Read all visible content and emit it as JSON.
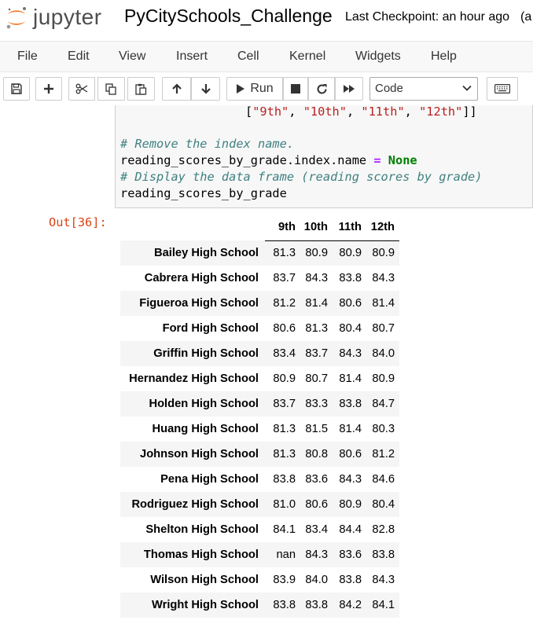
{
  "header": {
    "logo_text": "jupyter",
    "notebook_title": "PyCitySchools_Challenge",
    "checkpoint": "Last Checkpoint: an hour ago",
    "checkpoint_tail": "(a"
  },
  "menu": {
    "items": [
      "File",
      "Edit",
      "View",
      "Insert",
      "Cell",
      "Kernel",
      "Widgets",
      "Help"
    ]
  },
  "toolbar": {
    "run_label": "Run",
    "cell_type": "Code",
    "icons": [
      "save-icon",
      "plus-icon",
      "scissors-icon",
      "copy-icon",
      "paste-icon",
      "arrow-up-icon",
      "arrow-down-icon",
      "play-icon",
      "stop-icon",
      "restart-icon",
      "fast-forward-icon",
      "keyboard-icon"
    ]
  },
  "code": {
    "line0_open": "[",
    "line0_s1": "\"9th\"",
    "line0_sep1": ", ",
    "line0_s2": "\"10th\"",
    "line0_sep2": ", ",
    "line0_s3": "\"11th\"",
    "line0_sep3": ", ",
    "line0_s4": "\"12th\"",
    "line0_close": "]]",
    "comment1": "# Remove the index name.",
    "line2_a": "reading_scores_by_grade.index.name ",
    "line2_op": "=",
    "line2_sp": " ",
    "line2_kw": "None",
    "comment2": "# Display the data frame (reading scores by grade)",
    "line4": "reading_scores_by_grade"
  },
  "output": {
    "prompt": "Out[36]:",
    "columns": [
      "9th",
      "10th",
      "11th",
      "12th"
    ],
    "rows": [
      {
        "school": "Bailey High School",
        "values": [
          "81.3",
          "80.9",
          "80.9",
          "80.9"
        ]
      },
      {
        "school": "Cabrera High School",
        "values": [
          "83.7",
          "84.3",
          "83.8",
          "84.3"
        ]
      },
      {
        "school": "Figueroa High School",
        "values": [
          "81.2",
          "81.4",
          "80.6",
          "81.4"
        ]
      },
      {
        "school": "Ford High School",
        "values": [
          "80.6",
          "81.3",
          "80.4",
          "80.7"
        ]
      },
      {
        "school": "Griffin High School",
        "values": [
          "83.4",
          "83.7",
          "84.3",
          "84.0"
        ]
      },
      {
        "school": "Hernandez High School",
        "values": [
          "80.9",
          "80.7",
          "81.4",
          "80.9"
        ]
      },
      {
        "school": "Holden High School",
        "values": [
          "83.7",
          "83.3",
          "83.8",
          "84.7"
        ]
      },
      {
        "school": "Huang High School",
        "values": [
          "81.3",
          "81.5",
          "81.4",
          "80.3"
        ]
      },
      {
        "school": "Johnson High School",
        "values": [
          "81.3",
          "80.8",
          "80.6",
          "81.2"
        ]
      },
      {
        "school": "Pena High School",
        "values": [
          "83.8",
          "83.6",
          "84.3",
          "84.6"
        ]
      },
      {
        "school": "Rodriguez High School",
        "values": [
          "81.0",
          "80.6",
          "80.9",
          "80.4"
        ]
      },
      {
        "school": "Shelton High School",
        "values": [
          "84.1",
          "83.4",
          "84.4",
          "82.8"
        ]
      },
      {
        "school": "Thomas High School",
        "values": [
          "nan",
          "84.3",
          "83.6",
          "83.8"
        ]
      },
      {
        "school": "Wilson High School",
        "values": [
          "83.9",
          "84.0",
          "83.8",
          "84.3"
        ]
      },
      {
        "school": "Wright High School",
        "values": [
          "83.8",
          "83.8",
          "84.2",
          "84.1"
        ]
      }
    ]
  },
  "colors": {
    "logo_orange": "#f37726",
    "string_red": "#ba2121",
    "comment_teal": "#408080",
    "keyword_green": "#008000",
    "operator_purple": "#aa22ff",
    "prompt_out_red": "#d84315"
  }
}
